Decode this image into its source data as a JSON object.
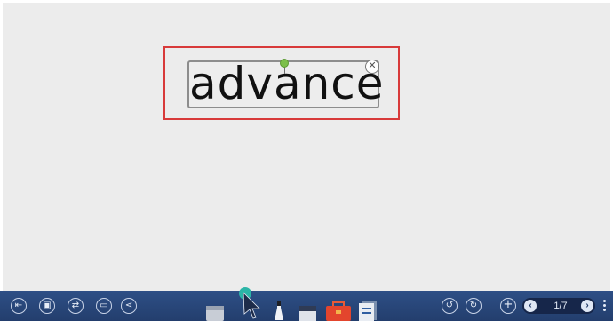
{
  "canvas": {
    "text_object": {
      "text": "advance"
    }
  },
  "taskbar": {
    "left_icons": [
      "exit-icon",
      "save-icon",
      "switch-icon",
      "record-icon",
      "share-icon"
    ],
    "tools": [
      "eraser-tool-icon",
      "pointer-tool-icon",
      "pen-tool-icon",
      "marker-tool-icon",
      "toolbox-icon",
      "document-icon"
    ],
    "page_indicator": "1/7",
    "colors": {
      "bar": "#2b4a80",
      "selection_outline": "#d83a3a",
      "rotate_handle": "#7cbf4a"
    }
  }
}
